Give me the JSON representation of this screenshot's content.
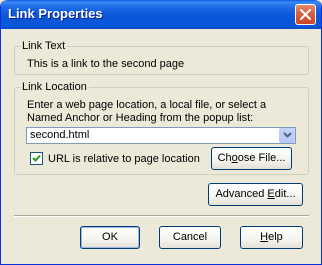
{
  "window": {
    "title": "Link Properties"
  },
  "link_text": {
    "group_label": "Link Text",
    "value": "This is a link to the second page"
  },
  "link_location": {
    "group_label": "Link Location",
    "instruction_line1": "Enter a web page location, a local file, or select a",
    "instruction_line2": "Named Anchor or Heading from the popup list:",
    "url_value": "second.html",
    "checkbox_label": "URL is relative to page location",
    "checkbox_checked": true,
    "choose_file": {
      "pre": "Ch",
      "mnemonic": "o",
      "post": "ose File..."
    }
  },
  "advanced_edit": {
    "pre": "Advanced ",
    "mnemonic": "E",
    "post": "dit..."
  },
  "buttons": {
    "ok": "OK",
    "cancel": "Cancel",
    "help": {
      "pre": "",
      "mnemonic": "H",
      "post": "elp"
    }
  },
  "colors": {
    "dialog_bg": "#ECE9D8",
    "titlebar": "#0A54D6",
    "close_button": "#D9603F",
    "checkmark": "#21A121"
  },
  "icons": {
    "close": "close-x-icon",
    "dropdown": "chevron-down-icon",
    "check": "checkmark-icon"
  }
}
